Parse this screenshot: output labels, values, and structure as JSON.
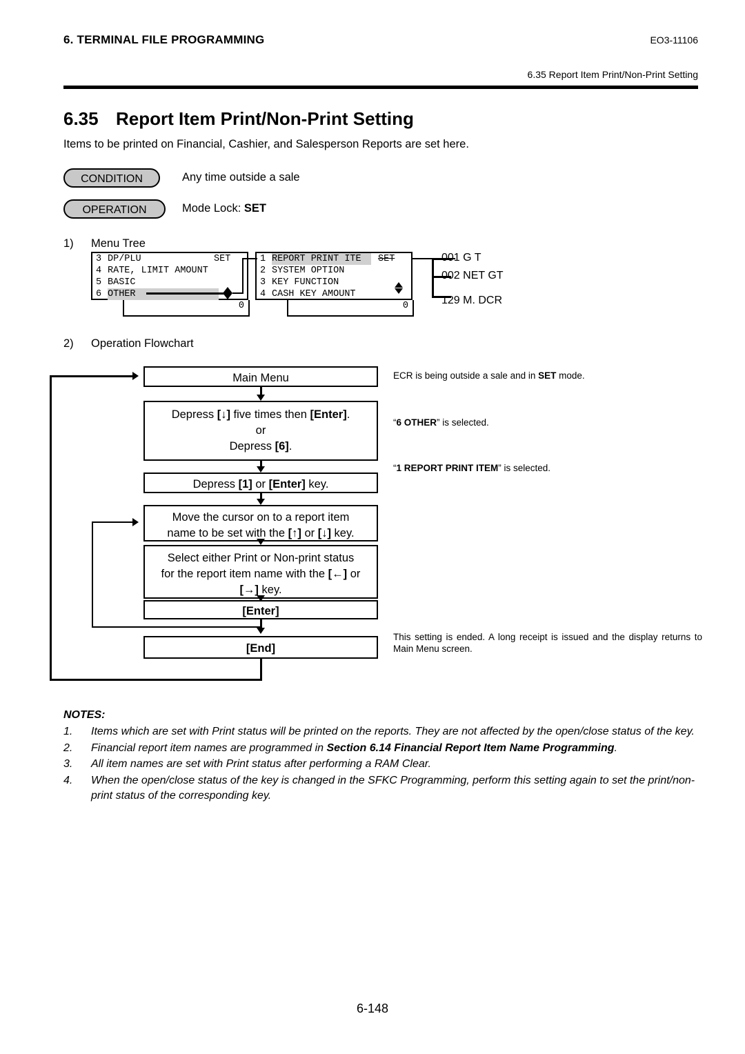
{
  "header": {
    "chapter": "6. TERMINAL FILE PROGRAMMING",
    "doc_code": "EO3-11106",
    "running_head": "6.35 Report Item Print/Non-Print Setting"
  },
  "section": {
    "number": "6.35",
    "title": "Report Item Print/Non-Print Setting",
    "intro": "Items to be printed on Financial, Cashier, and Salesperson Reports are set here."
  },
  "condition": {
    "label": "CONDITION",
    "text": "Any time outside a sale"
  },
  "operation": {
    "label": "OPERATION",
    "text_prefix": "Mode Lock: ",
    "text_bold": "SET"
  },
  "menu_tree": {
    "step_number": "1)",
    "step_label": "Menu Tree",
    "screen1": {
      "rows": [
        {
          "num": "3",
          "name": "DP/PLU",
          "right": "SET",
          "highlight": false
        },
        {
          "num": "4",
          "name": "RATE, LIMIT AMOUNT",
          "right": "",
          "highlight": false
        },
        {
          "num": "5",
          "name": "BASIC",
          "right": "",
          "highlight": false
        },
        {
          "num": "6",
          "name": "OTHER",
          "right": "",
          "highlight": true
        }
      ],
      "status": "0"
    },
    "screen2": {
      "rows": [
        {
          "num": "1",
          "name": "REPORT PRINT ITE",
          "right": "SET",
          "highlight": true
        },
        {
          "num": "2",
          "name": "SYSTEM OPTION",
          "right": "",
          "highlight": false
        },
        {
          "num": "3",
          "name": "KEY FUNCTION",
          "right": "",
          "highlight": false
        },
        {
          "num": "4",
          "name": "CASH KEY AMOUNT",
          "right": "",
          "highlight": false
        }
      ],
      "status": "0"
    },
    "right_items": [
      {
        "code": "001",
        "name": "G T"
      },
      {
        "code": "002",
        "name": "NET GT"
      },
      {
        "code": "129",
        "name": "M. DCR"
      }
    ]
  },
  "flowchart": {
    "step_number": "2)",
    "step_label": "Operation Flowchart",
    "boxes": [
      {
        "lines": [
          "Main Menu"
        ]
      },
      {
        "lines": [
          "Depress [↓] five times then [Enter].",
          "or",
          "Depress [6]."
        ]
      },
      {
        "lines": [
          "Depress [1] or [Enter] key."
        ]
      },
      {
        "lines": [
          "Move the cursor on to a report item",
          "name to be set with the [↑] or [↓] key."
        ]
      },
      {
        "lines": [
          "Select either Print or Non-print status",
          "for the report item name with the [←] or",
          "[→] key."
        ]
      },
      {
        "lines": [
          "[Enter]"
        ]
      },
      {
        "lines": [
          "[End]"
        ]
      }
    ],
    "annotations": [
      "ECR is being outside a sale and in SET mode.",
      "“6 OTHER” is selected.",
      "“1 REPORT PRINT ITEM” is selected.",
      "This setting is ended.   A long  receipt  is  issued  and  the  display returns to Main Menu screen."
    ]
  },
  "notes": {
    "heading": "NOTES:",
    "items": [
      {
        "num": "1.",
        "text": "Items which are set with Print status will be printed on the reports.  They are not affected by the open/close status of the key."
      },
      {
        "num": "2.",
        "text_before": "Financial report item names are programmed in ",
        "text_bold": "Section 6.14 Financial Report Item Name Programming",
        "text_after": "."
      },
      {
        "num": "3.",
        "text": "All item names are set with Print status after performing a RAM Clear."
      },
      {
        "num": "4.",
        "text": "When the open/close status of the key is changed in the SFKC Programming, perform this setting again to set the print/non-print status of the corresponding key."
      }
    ]
  },
  "footer": {
    "page": "6-148"
  }
}
